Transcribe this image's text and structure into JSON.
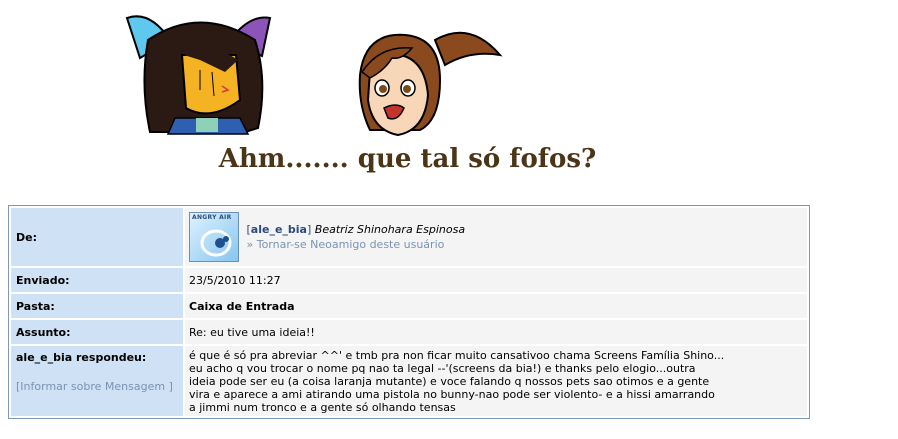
{
  "caption": "Ahm....... que tal só fofos?",
  "message": {
    "from_label": "De:",
    "avatar_text": "ANGRY AIR",
    "username": "ale_e_bia",
    "bracket_open": "[",
    "bracket_close": "]",
    "full_name": "Beatriz Shinohara Espinosa",
    "neoamigo_link": "» Tornar-se Neoamigo deste usuário",
    "sent_label": "Enviado:",
    "sent_value": "23/5/2010 11:27",
    "folder_label": "Pasta:",
    "folder_value": "Caixa de Entrada",
    "subject_label": "Assunto:",
    "subject_value": "Re: eu tive uma ideia!!",
    "replied_label": "ale_e_bia respondeu:",
    "report_link": "[Informar sobre Mensagem ]",
    "body_lines": [
      "é que é só pra abreviar ^^' e tmb pra non ficar muito cansativoo chama Screens Família Shino...",
      "eu acho q vou trocar o nome pq nao ta legal --'(screens da bia!) e thanks pelo elogio...outra",
      "ideia pode ser eu (a coisa laranja mutante) e voce falando q nossos pets sao otimos e a gente",
      "vira e aparece a ami atirando uma pistola no bunny-nao pode ser violento- e a hissi amarrando",
      "a jimmi num tronco e a gente só olhando tensas"
    ]
  },
  "colors": {
    "label_bg": "#cfe1f5",
    "value_bg": "#f4f4f4",
    "border": "#7b97bd",
    "caption": "#4a3516",
    "link": "#7a93b3"
  }
}
